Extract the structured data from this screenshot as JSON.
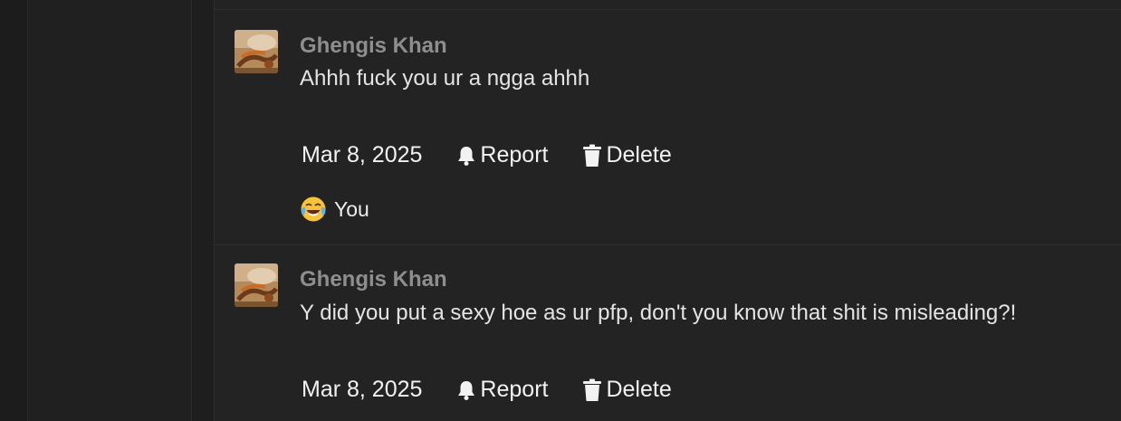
{
  "comments": [
    {
      "author": "Ghengis Khan",
      "text": "Ahhh fuck you ur a ngga ahhh",
      "date": "Mar 8, 2025",
      "report_label": "Report",
      "delete_label": "Delete",
      "reaction": {
        "emoji": "face-with-tears-of-joy",
        "label": "You"
      }
    },
    {
      "author": "Ghengis Khan",
      "text": "Y did you put a sexy hoe as ur pfp, don't you know that shit is misleading?!",
      "date": "Mar 8, 2025",
      "report_label": "Report",
      "delete_label": "Delete"
    }
  ],
  "colors": {
    "background": "#1d1d1d",
    "thread_bg": "#232323",
    "author": "#8e8e8e",
    "text": "#e4e4e4"
  }
}
